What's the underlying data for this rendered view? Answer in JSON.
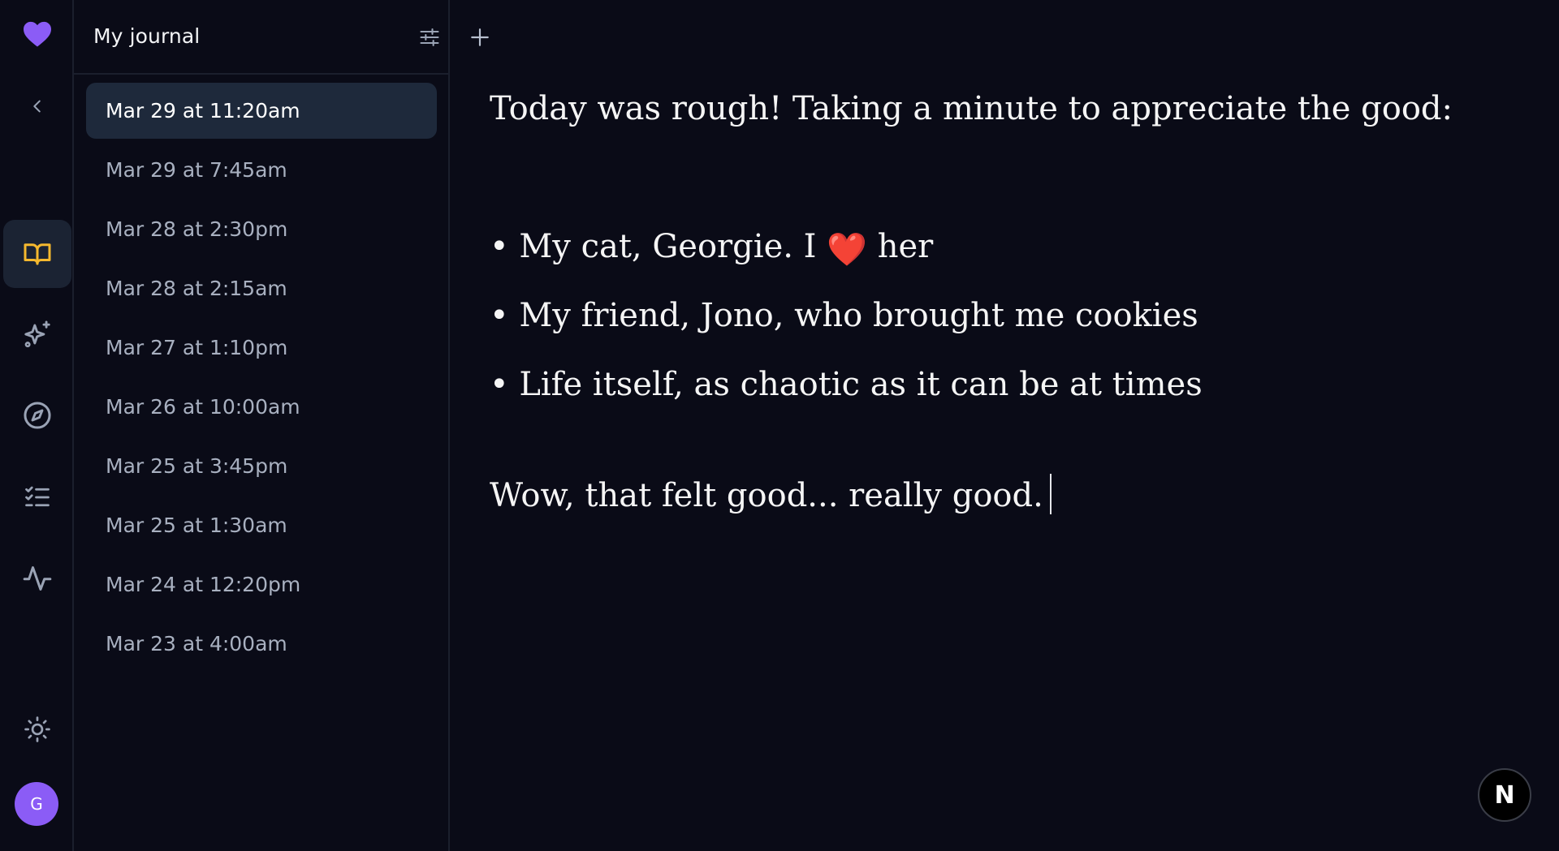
{
  "colors": {
    "background": "#0a0b17",
    "brand_heart": "#8b5cf6",
    "active_icon": "#f5b82e",
    "selected_entry_bg": "#1e293b",
    "muted_text": "#a8b0c0"
  },
  "rail": {
    "logo_icon": "heart-icon",
    "collapse_icon": "chevron-left-icon",
    "nav_items": [
      {
        "icon": "book-open-icon",
        "active": true
      },
      {
        "icon": "sparkles-icon",
        "active": false
      },
      {
        "icon": "compass-icon",
        "active": false
      },
      {
        "icon": "checklist-icon",
        "active": false
      },
      {
        "icon": "activity-icon",
        "active": false
      }
    ],
    "theme_icon": "sun-icon",
    "avatar_initial": "G"
  },
  "panel": {
    "title": "My journal",
    "filter_icon": "sliders-icon",
    "add_icon": "plus-icon",
    "entries": [
      {
        "label": "Mar 29 at 11:20am",
        "selected": true
      },
      {
        "label": "Mar 29 at 7:45am",
        "selected": false
      },
      {
        "label": "Mar 28 at 2:30pm",
        "selected": false
      },
      {
        "label": "Mar 28 at 2:15am",
        "selected": false
      },
      {
        "label": "Mar 27 at 1:10pm",
        "selected": false
      },
      {
        "label": "Mar 26 at 10:00am",
        "selected": false
      },
      {
        "label": "Mar 25 at 3:45pm",
        "selected": false
      },
      {
        "label": "Mar 25 at 1:30am",
        "selected": false
      },
      {
        "label": "Mar 24 at 12:20pm",
        "selected": false
      },
      {
        "label": "Mar 23 at 4:00am",
        "selected": false
      }
    ]
  },
  "editor": {
    "intro": "Today was rough! Taking a minute to appreciate the good:",
    "bullet_marker": "•",
    "bullets": {
      "b1_before": "My cat, Georgie. I",
      "b1_emoji": "❤️",
      "b1_after": "her",
      "b2": "My friend, Jono, who brought me cookies",
      "b3": "Life itself, as chaotic as it can be at times"
    },
    "outro": "Wow, that felt good... really good."
  },
  "badge": {
    "label": "N",
    "icon": "nextjs-icon"
  }
}
